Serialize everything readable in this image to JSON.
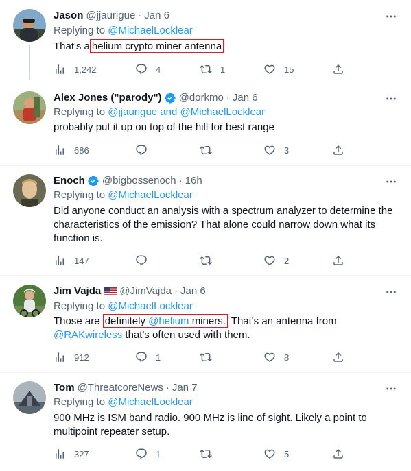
{
  "tweets": [
    {
      "name": "Jason",
      "handle": "@jjaurigue",
      "time": "Jan 6",
      "replying_prefix": "Replying to",
      "replying_to": "@MichaelLocklear",
      "text_before": "That's a",
      "text_highlight": "helium crypto miner antenna",
      "views": "1,242",
      "replies": "4",
      "retweets": "1",
      "likes": "15"
    },
    {
      "name": "Alex Jones (\"parody\")",
      "handle": "@dorkmo",
      "time": "Jan 6",
      "replying_prefix": "Replying to",
      "replying_to": "@jjaurigue and @MichaelLocklear",
      "text": "probably put it up on top of the hill for best range",
      "views": "686",
      "replies": "",
      "retweets": "",
      "likes": "3"
    },
    {
      "name": "Enoch",
      "handle": "@bigbossenoch",
      "time": "16h",
      "replying_prefix": "Replying to",
      "replying_to": "@MichaelLocklear",
      "text": "Did anyone conduct an analysis with a spectrum analyzer to determine the characteristics of the emission? That alone could narrow down what its function is.",
      "views": "147",
      "replies": "",
      "retweets": "",
      "likes": "2"
    },
    {
      "name": "Jim Vajda",
      "handle": "@JimVajda",
      "time": "Jan 6",
      "replying_prefix": "Replying to",
      "replying_to": "@MichaelLocklear",
      "text_1": "Those are",
      "text_hl_word": "definitely",
      "text_hl_link": "@helium",
      "text_hl_word2": "miners.",
      "text_2": "That's an antenna from",
      "text_link": "@RAKwireless",
      "text_3": "that's often used with them.",
      "views": "912",
      "replies": "1",
      "retweets": "",
      "likes": "8"
    },
    {
      "name": "Tom",
      "handle": "@ThreatcoreNews",
      "time": "Jan 7",
      "replying_prefix": "Replying to",
      "replying_to": "@MichaelLocklear",
      "text": "900 MHz is ISM band radio. 900 MHz is line of sight. Likely a point to multipoint repeater setup.",
      "views": "327",
      "replies": "1",
      "retweets": "",
      "likes": "5"
    }
  ],
  "colors": {
    "text": "#0f1419",
    "secondary": "#536471",
    "link": "#1d9bf0",
    "highlight_box": "#d0222b",
    "divider": "#eff3f4"
  },
  "icons": [
    "views-icon",
    "reply-icon",
    "retweet-icon",
    "like-icon",
    "share-icon",
    "more-icon",
    "verified-badge-icon",
    "us-flag-icon"
  ]
}
